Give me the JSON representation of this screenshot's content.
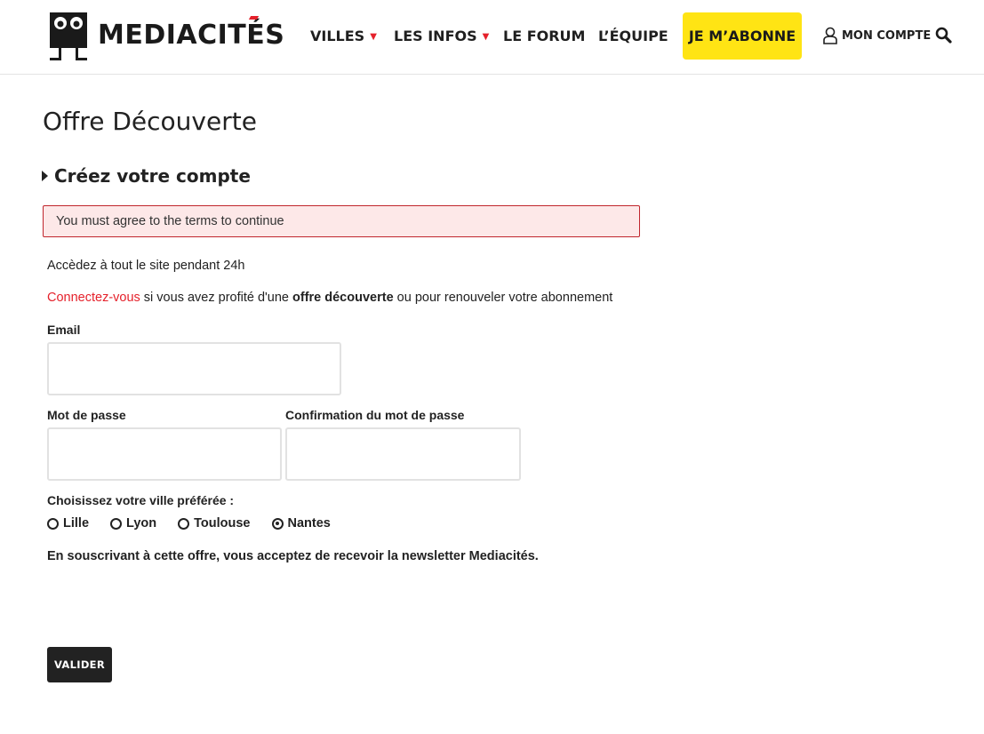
{
  "brand": {
    "name_prefix": "MEDIACIT",
    "name_accent": "É",
    "name_suffix": "S",
    "accent_color": "#e5212b"
  },
  "nav": {
    "items": [
      {
        "label": "VILLES",
        "has_dropdown": true
      },
      {
        "label": "LES INFOS",
        "has_dropdown": true
      },
      {
        "label": "LE FORUM",
        "has_dropdown": false
      },
      {
        "label": "L’ÉQUIPE",
        "has_dropdown": false
      }
    ],
    "subscribe_label": "JE M’ABONNE",
    "subscribe_color": "#ffe414",
    "account_label": "MON COMPTE",
    "account_icon": "user-icon",
    "search_icon": "search-icon"
  },
  "page": {
    "title": "Offre Découverte",
    "section_title": "Créez votre compte",
    "alert_message": "You must agree to the terms to continue",
    "lead": "Accèdez à tout le site pendant 24h",
    "connect": {
      "link": "Connectez-vous",
      "text_before_bold": " si vous avez profité d'une ",
      "bold": "offre découverte",
      "text_after_bold": " ou pour renouveler votre abonnement"
    }
  },
  "form": {
    "email_label": "Email",
    "email_value": "",
    "password_label": "Mot de passe",
    "password_value": "",
    "confirm_label": "Confirmation du mot de passe",
    "confirm_value": "",
    "city_label": "Choisissez votre ville préférée :",
    "cities": [
      {
        "label": "Lille",
        "checked": false
      },
      {
        "label": "Lyon",
        "checked": false
      },
      {
        "label": "Toulouse",
        "checked": false
      },
      {
        "label": "Nantes",
        "checked": true
      }
    ],
    "newsletter_note": "En souscrivant à cette offre, vous acceptez de recevoir la newsletter Mediacités.",
    "submit_label": "VALIDER"
  }
}
